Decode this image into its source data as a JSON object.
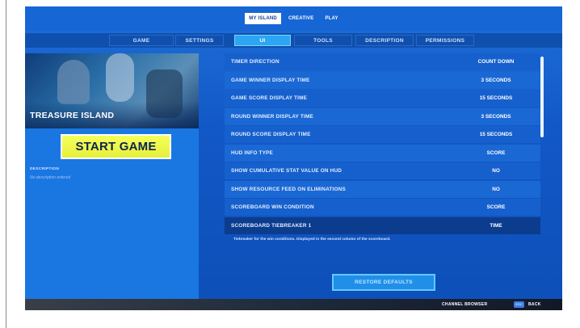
{
  "top_tabs": [
    {
      "label": "MY ISLAND",
      "active": true
    },
    {
      "label": "CREATIVE",
      "active": false
    },
    {
      "label": "PLAY",
      "active": false
    }
  ],
  "sub_tabs": [
    {
      "label": "GAME",
      "active": false
    },
    {
      "label": "SETTINGS",
      "active": false
    },
    {
      "label": "UI",
      "active": true
    },
    {
      "label": "TOOLS",
      "active": false
    },
    {
      "label": "DESCRIPTION",
      "active": false
    },
    {
      "label": "PERMISSIONS",
      "active": false
    }
  ],
  "island": {
    "title": "TREASURE ISLAND",
    "start_label": "START GAME",
    "description_label": "DESCRIPTION",
    "description_text": "No description entered"
  },
  "settings": [
    {
      "label": "TIMER DIRECTION",
      "value": "COUNT DOWN"
    },
    {
      "label": "GAME WINNER DISPLAY TIME",
      "value": "3 SECONDS"
    },
    {
      "label": "GAME SCORE DISPLAY TIME",
      "value": "15 SECONDS"
    },
    {
      "label": "ROUND WINNER DISPLAY TIME",
      "value": "3 SECONDS"
    },
    {
      "label": "ROUND SCORE DISPLAY TIME",
      "value": "15 SECONDS"
    },
    {
      "label": "HUD INFO TYPE",
      "value": "SCORE"
    },
    {
      "label": "SHOW CUMULATIVE STAT VALUE ON HUD",
      "value": "NO"
    },
    {
      "label": "SHOW RESOURCE FEED ON ELIMINATIONS",
      "value": "NO"
    },
    {
      "label": "SCOREBOARD WIN CONDITION",
      "value": "SCORE"
    },
    {
      "label": "SCOREBOARD TIEBREAKER 1",
      "value": "TIME"
    }
  ],
  "hint": "Tiebreaker for the win conditions. Displayed in the second column of the scoreboard.",
  "restore_label": "RESTORE DEFAULTS",
  "bottom": {
    "channel_browser": "CHANNEL BROWSER",
    "back_key": "ESC",
    "back_label": "BACK"
  },
  "colors": {
    "accent_yellow": "#e7f03b",
    "background_blue": "#1258c6",
    "active_tab": "#2aa6f2"
  }
}
